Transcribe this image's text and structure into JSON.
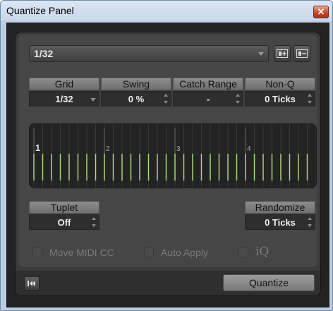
{
  "window": {
    "title": "Quantize Panel",
    "close_glyph": "✕"
  },
  "preset": {
    "value": "1/32"
  },
  "params": [
    {
      "label": "Grid",
      "value": "1/32",
      "control": "dropdown"
    },
    {
      "label": "Swing",
      "value": "0 %",
      "control": "spinner"
    },
    {
      "label": "Catch Range",
      "value": "-",
      "control": "spinner"
    },
    {
      "label": "Non-Q",
      "value": "0 Ticks",
      "control": "spinner"
    }
  ],
  "grid_display": {
    "bar_labels": [
      "1",
      "2",
      "3",
      "4"
    ],
    "lines_per_bar": 8,
    "line_color": "#a9d67a"
  },
  "tuplet": {
    "label": "Tuplet",
    "value": "Off"
  },
  "randomize": {
    "label": "Randomize",
    "value": "0 Ticks"
  },
  "options": [
    {
      "label": "Move MIDI CC",
      "checked": false
    },
    {
      "label": "Auto Apply",
      "checked": false
    },
    {
      "label": "iQ",
      "checked": false
    }
  ],
  "buttons": {
    "quantize_label": "Quantize"
  }
}
